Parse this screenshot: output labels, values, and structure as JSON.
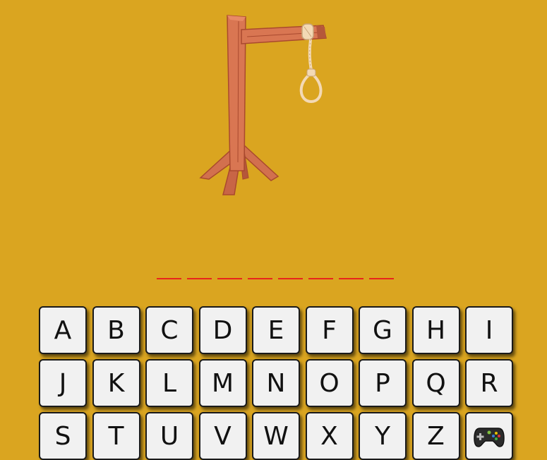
{
  "game": {
    "word_length": 8,
    "revealed": [
      "",
      "",
      "",
      "",
      "",
      "",
      "",
      ""
    ]
  },
  "keyboard": {
    "keys": [
      "A",
      "B",
      "C",
      "D",
      "E",
      "F",
      "G",
      "H",
      "I",
      "J",
      "K",
      "L",
      "M",
      "N",
      "O",
      "P",
      "Q",
      "R",
      "S",
      "T",
      "U",
      "V",
      "W",
      "X",
      "Y",
      "Z"
    ],
    "extra_icon": "gamepad-icon"
  },
  "colors": {
    "background": "#DAA520",
    "wood": "#D2704E",
    "wood_dark": "#A9492E",
    "rope": "#F3D9B5",
    "slot_underline": "#E8251C",
    "key_face": "#F1F1F1"
  }
}
